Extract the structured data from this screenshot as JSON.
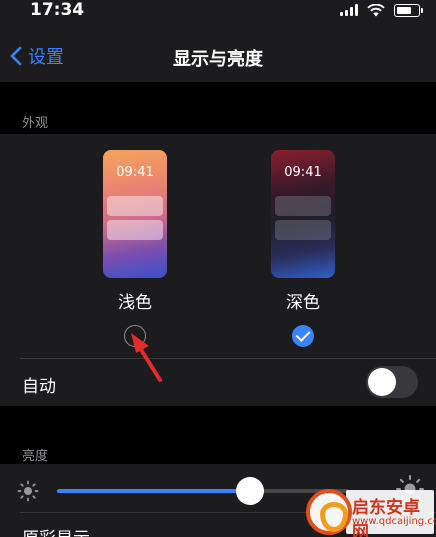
{
  "status_bar": {
    "time": "17:34",
    "battery_level": 0.7
  },
  "nav": {
    "back_label": "设置",
    "title": "显示与亮度"
  },
  "appearance": {
    "section_label": "外观",
    "options": [
      {
        "label": "浅色",
        "preview_time": "09:41",
        "selected": false
      },
      {
        "label": "深色",
        "preview_time": "09:41",
        "selected": true
      }
    ],
    "auto": {
      "label": "自动",
      "enabled": false
    }
  },
  "brightness": {
    "section_label": "亮度",
    "level": 0.66,
    "next_row_label": "原彩显示"
  },
  "watermark": {
    "title": "启东安卓网",
    "url": "www.qdcaijing.com"
  },
  "colors": {
    "accent": "#3a82f7",
    "annotation_arrow": "#e32b2b"
  }
}
